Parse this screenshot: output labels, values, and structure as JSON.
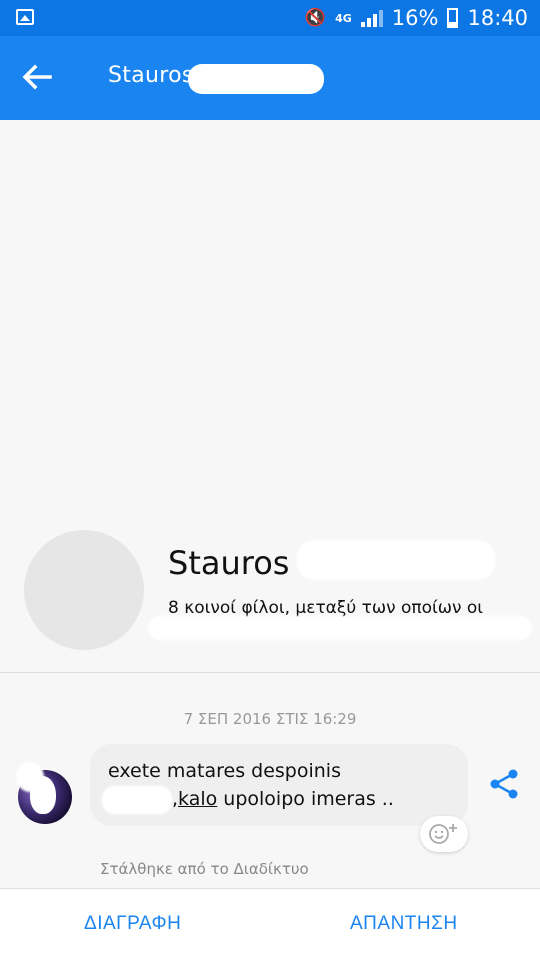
{
  "status_bar": {
    "network": "4G",
    "battery": "16%",
    "time": "18:40"
  },
  "header": {
    "title": "Stauros"
  },
  "contact_card": {
    "name": "Stauros",
    "mutual_friends": "8 κοινοί φίλοι, μεταξύ των οποίων οι"
  },
  "message": {
    "timestamp": "7 ΣΕΠ 2016 ΣΤΙΣ 16:29",
    "line1": "exete matares despoinis",
    "line2_link": "kalo",
    "line2_rest": " upoloipo imeras ..",
    "line2_prefix": ",",
    "sent_via": "Στάλθηκε από το Διαδίκτυο"
  },
  "actions": {
    "delete_label": "ΔΙΑΓΡΑΦΗ",
    "reply_label": "ΑΠΑΝΤΗΣΗ"
  },
  "colors": {
    "appbar": "#1a85f1",
    "statusbar": "#0c76e5",
    "accent": "#1a85f1"
  }
}
